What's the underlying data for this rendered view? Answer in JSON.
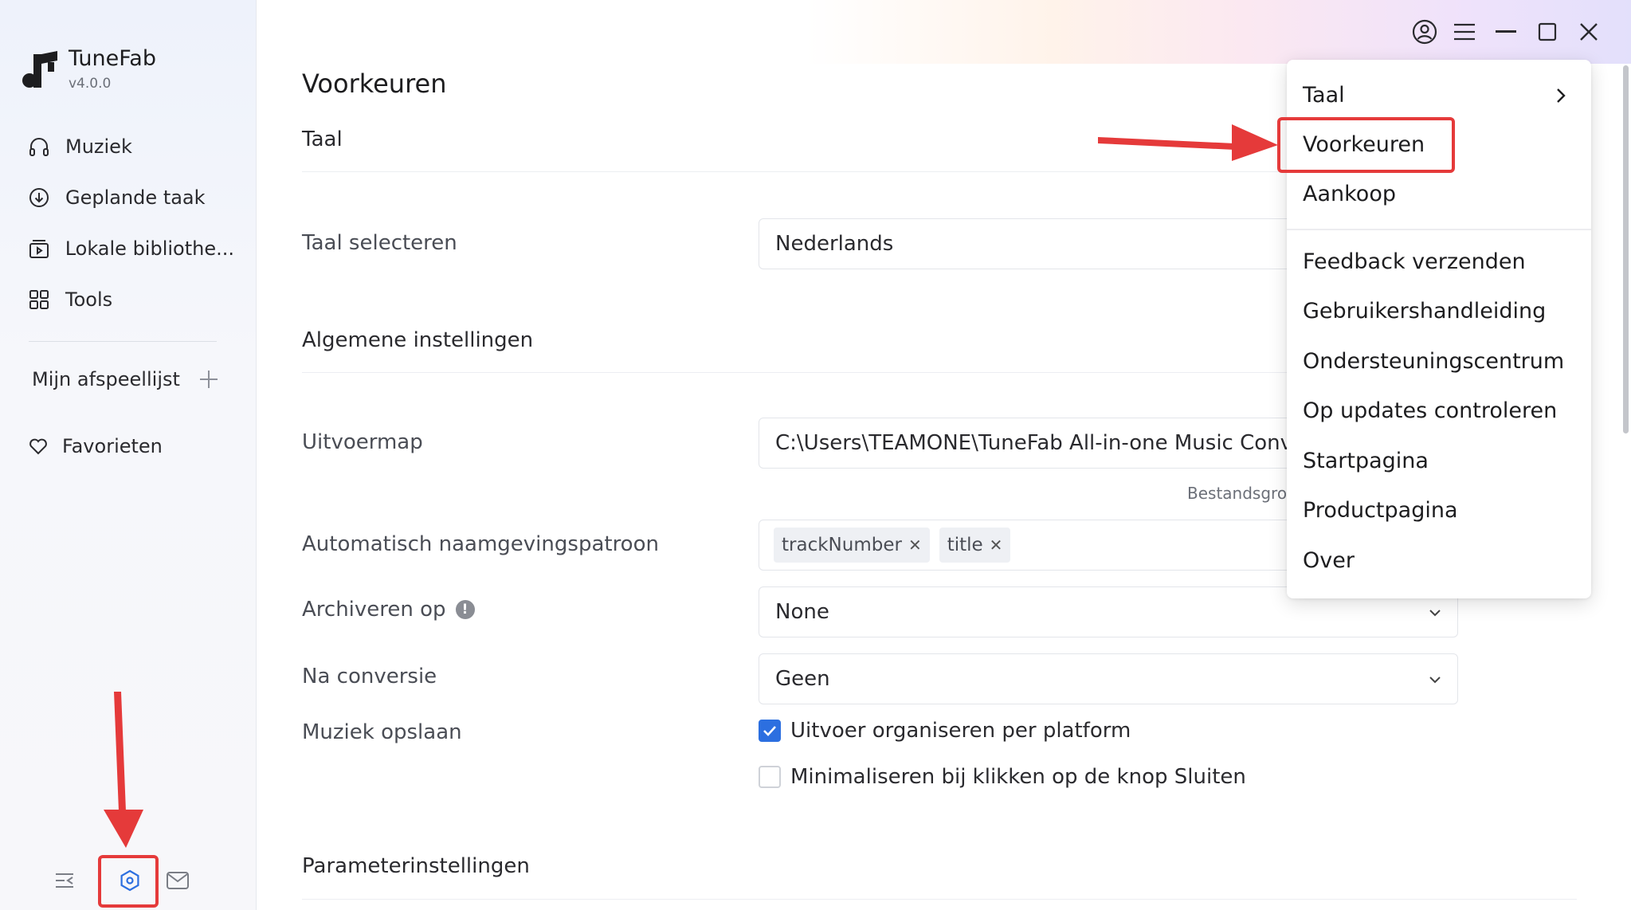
{
  "app": {
    "name": "TuneFab",
    "version": "v4.0.0"
  },
  "sidebar": {
    "items": [
      {
        "label": "Muziek",
        "icon": "headphones-icon"
      },
      {
        "label": "Geplande taak",
        "icon": "download-circle-icon"
      },
      {
        "label": "Lokale bibliothe...",
        "icon": "library-icon"
      },
      {
        "label": "Tools",
        "icon": "grid-icon"
      }
    ],
    "playlist_label": "Mijn afspeellijst",
    "favorites_label": "Favorieten"
  },
  "main": {
    "page_title": "Voorkeuren",
    "sections": {
      "language": "Taal",
      "general": "Algemene instellingen",
      "parameters": "Parameterinstellingen"
    },
    "rows": {
      "language_select_label": "Taal selecteren",
      "language_value": "Nederlands",
      "output_folder_label": "Uitvoermap",
      "output_folder_value": "C:\\Users\\TEAMONE\\TuneFab All-in-one Music Converter",
      "output_folder_note": "Bestandsgrootte",
      "naming_label": "Automatisch naamgevingspatroon",
      "naming_chips": [
        "trackNumber",
        "title"
      ],
      "archive_label": "Archiveren op",
      "archive_value": "None",
      "after_conversion_label": "Na conversie",
      "after_conversion_value": "Geen",
      "save_music_label": "Muziek opslaan",
      "checkbox_organize": "Uitvoer organiseren per platform",
      "checkbox_minimize": "Minimaliseren bij klikken op de knop Sluiten"
    }
  },
  "menu": {
    "items_top": [
      "Taal",
      "Voorkeuren",
      "Aankoop"
    ],
    "items_bottom": [
      "Feedback verzenden",
      "Gebruikershandleiding",
      "Ondersteuningscentrum",
      "Op updates controleren",
      "Startpagina",
      "Productpagina",
      "Over"
    ]
  },
  "colors": {
    "accent_blue": "#2c6fe0",
    "annotation_red": "#e53a3a"
  }
}
